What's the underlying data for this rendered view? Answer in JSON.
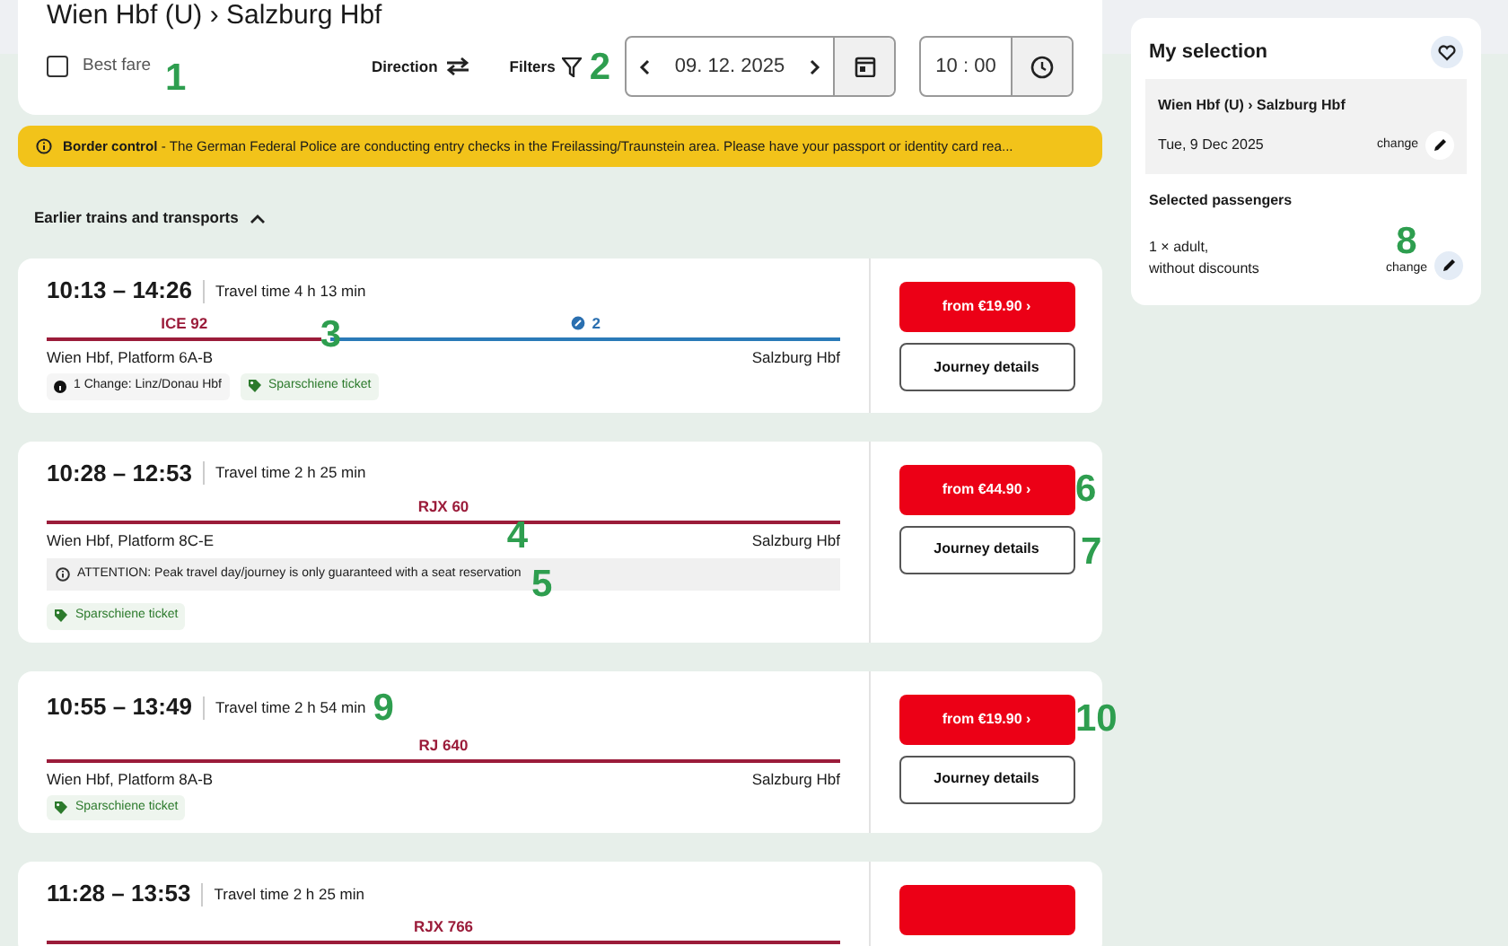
{
  "header": {
    "title": "Wien Hbf (U) › Salzburg Hbf"
  },
  "controls": {
    "best_fare": {
      "label": "Best fare",
      "checked": false,
      "callout": "1"
    },
    "direction": {
      "label": "Direction"
    },
    "filters": {
      "label": "Filters",
      "callout": "2"
    },
    "date": {
      "value": "09. 12. 2025"
    },
    "time": {
      "value": "10 : 00"
    }
  },
  "notice": {
    "text": "**Border control** - The German Federal Police are conducting entry checks in the Freilassing/Traunstein area. Please have your passport or identity card rea..."
  },
  "earlier": {
    "label": "Earlier trains and transports",
    "expanded": true
  },
  "journeys": [
    {
      "time": "10:13 – 14:26",
      "travel_time": "Travel time 4 h 13 min",
      "segments": [
        {
          "kind": "train",
          "label": "ICE 92"
        },
        {
          "kind": "local",
          "label": "2",
          "callout": "3"
        }
      ],
      "from": "Wien Hbf, Platform 6A-B",
      "to": "Salzburg Hbf",
      "chips": [
        {
          "kind": "change",
          "label": "1 Change: Linz/Donau Hbf"
        },
        {
          "kind": "tag",
          "label": "Sparschiene ticket"
        }
      ],
      "price": "from €19.90 ›",
      "details": "Journey details"
    },
    {
      "time": "10:28 – 12:53",
      "travel_time": "Travel time 2 h 25 min",
      "segments": [
        {
          "kind": "train",
          "label": "RJX 60",
          "callout": "4"
        }
      ],
      "from": "Wien Hbf, Platform 8C-E",
      "to": "Salzburg Hbf",
      "warning": {
        "text": "ATTENTION: Peak travel day/journey is only guaranteed with a seat reservation",
        "callout": "5"
      },
      "chips": [
        {
          "kind": "tag",
          "label": "Sparschiene ticket"
        }
      ],
      "price": "from €44.90 ›",
      "price_callout": "6",
      "details": "Journey details",
      "details_callout": "7"
    },
    {
      "time": "10:55 – 13:49",
      "travel_time": "Travel time 2 h 54 min",
      "travel_callout": "9",
      "segments": [
        {
          "kind": "train",
          "label": "RJ 640"
        }
      ],
      "from": "Wien Hbf, Platform 8A-B",
      "to": "Salzburg Hbf",
      "chips": [
        {
          "kind": "tag",
          "label": "Sparschiene ticket"
        }
      ],
      "price": "from €19.90 ›",
      "price_callout": "10",
      "details": "Journey details"
    },
    {
      "time": "11:28 – 13:53",
      "travel_time": "Travel time 2 h 25 min",
      "segments": [
        {
          "kind": "train",
          "label": "RJX 766"
        }
      ]
    }
  ],
  "sidebar": {
    "title": "My selection",
    "route": "Wien Hbf (U) › Salzburg Hbf",
    "date": "Tue, 9 Dec 2025",
    "route_change": "change",
    "passengers_title": "Selected passengers",
    "passengers": [
      "1 × adult,",
      "without discounts"
    ],
    "passengers_change": "change",
    "callout": "8"
  }
}
